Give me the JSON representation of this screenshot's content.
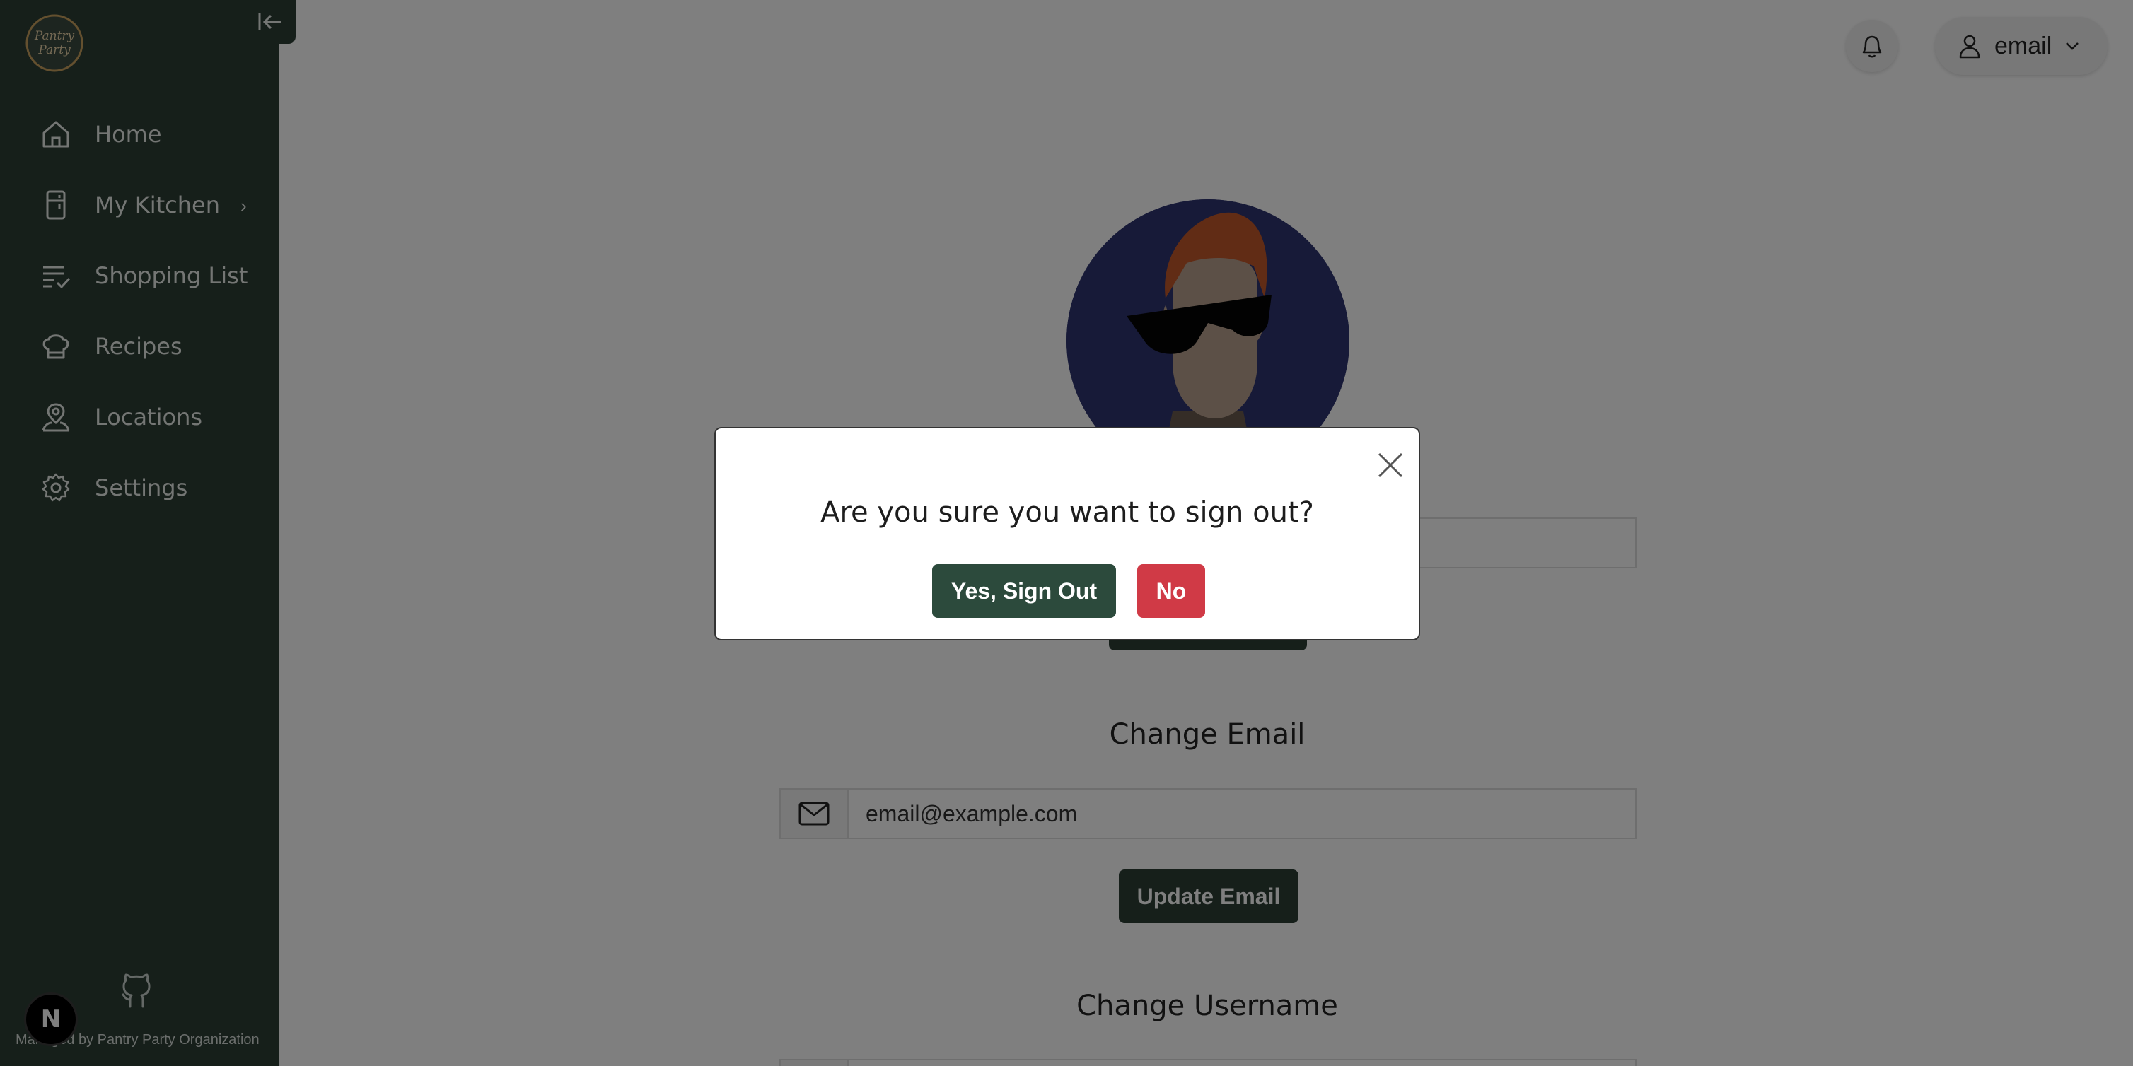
{
  "sidebar": {
    "logo_alt": "Pantry Party",
    "items": [
      {
        "label": "Home",
        "icon": "home-icon"
      },
      {
        "label": "My Kitchen",
        "icon": "fridge-icon",
        "has_submenu": true
      },
      {
        "label": "Shopping List",
        "icon": "checklist-icon"
      },
      {
        "label": "Recipes",
        "icon": "chef-hat-icon"
      },
      {
        "label": "Locations",
        "icon": "location-person-icon"
      },
      {
        "label": "Settings",
        "icon": "gear-icon"
      }
    ],
    "footer_text": "Managed by Pantry Party Organization",
    "badge_letter": "N"
  },
  "header": {
    "user_label": "email"
  },
  "profile": {
    "change_email_title": "Change Email",
    "email_value": "email@example.com",
    "update_email_label": "Update Email",
    "change_username_title": "Change Username"
  },
  "modal": {
    "message": "Are you sure you want to sign out?",
    "confirm_label": "Yes, Sign Out",
    "cancel_label": "No"
  },
  "colors": {
    "sidebar_bg": "#2c3e35",
    "primary_button": "#2c4a3c",
    "danger_button": "#d03a46",
    "avatar_bg": "#2e3470"
  }
}
